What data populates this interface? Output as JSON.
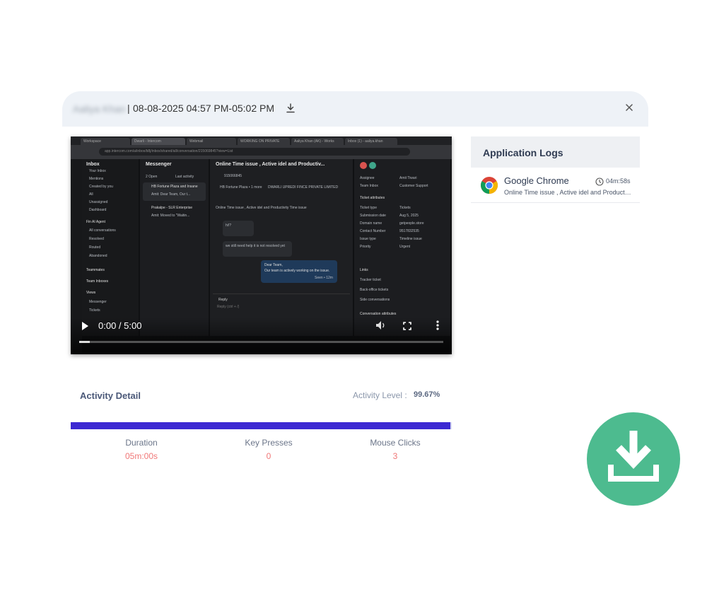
{
  "header": {
    "user_name": "Aaliya Khan",
    "separator": "|",
    "session_time": "08-08-2025 04:57 PM-05:02 PM"
  },
  "video": {
    "current_time": "0:00",
    "duration": "5:00",
    "time_display": "0:00 / 5:00",
    "progress_fraction": 0.03,
    "screen": {
      "inbox_title": "Inbox",
      "inbox_items": [
        "Your Inbox",
        "Mentions",
        "Created by you",
        "All",
        "Unassigned",
        "Dashboard"
      ],
      "section_ai": "Fin AI Agent",
      "ai_items": [
        "All conversations",
        "Resolved",
        "Routed",
        "Abandoned"
      ],
      "section_teammates": "Teammates",
      "section_team_inboxes": "Team Inboxes",
      "section_views": "Views",
      "view_items": [
        "Messenger",
        "Tickets"
      ],
      "messenger_title": "Messenger",
      "messenger_filter": "2 Open",
      "messenger_sort": "Last activity",
      "conversations": [
        {
          "title": "HB Fortune Plaza and Insane",
          "preview": "Amit: Dear Team, Our t..."
        },
        {
          "title": "Prakalpe - SLR Enterprise",
          "preview": "Amit: Moved to \"Waitin..."
        }
      ],
      "chat_title": "Online Time issue , Active idel and Productiv...",
      "chat_id": "915066845",
      "chat_company": "HB Fortune Plaza • 1 more",
      "chat_org": "DWARLI UPREDI FINCE PRIVATE LIMITED",
      "chat_subject": "Online Time issue , Active idel and Productivity Time issue",
      "msg1": "hi!?",
      "msg2": "we still need help it is not resolved yet",
      "msg3_line1": "Dear Team,",
      "msg3_line2": "Our team is actively working on the issue.",
      "msg3_meta": "Seen • 12m",
      "reply_label": "Reply",
      "reply_placeholder": "Reply (ctrl + /)",
      "side_assignee_label": "Assignee",
      "side_assignee": "Amit Tiwari",
      "side_team_label": "Team Inbox",
      "side_team": "Customer Support",
      "side_ticket_section": "Ticket attributes",
      "side_rows": [
        [
          "Ticket type",
          "Tickets"
        ],
        [
          "Submission date",
          "Aug 5, 2025"
        ],
        [
          "Domain name",
          "getpeople.store"
        ],
        [
          "Contact Number",
          "9517832535"
        ],
        [
          "Issue type",
          "Timeline issue"
        ],
        [
          "Priority",
          "Urgent"
        ]
      ],
      "side_links": "Links",
      "side_link_items": [
        "Tracker ticket",
        "Back-office tickets",
        "Side conversations"
      ],
      "side_conv_attrs": "Conversation attributes",
      "tabs": [
        "Workspace",
        "Dwarli - Intercom",
        "Webmail",
        "WORKING ON PRIVATE",
        "Aaliya Khan (AK) - Works",
        "Inbox (1) - aaliya.khan"
      ],
      "url": "app.intercom.com/a/inbox/b8j/inbox/shared/all/conversation/215069845?view=List"
    }
  },
  "app_logs": {
    "title": "Application Logs",
    "items": [
      {
        "name": "Google Chrome",
        "duration": "04m:58s",
        "description": "Online Time issue , Active idel and Productivity Time issue"
      }
    ]
  },
  "activity": {
    "title": "Activity Detail",
    "level_label": "Activity Level :",
    "level_value": "99.67%",
    "level_fraction": 0.9967,
    "metrics": [
      {
        "label": "Duration",
        "value": "05m:00s"
      },
      {
        "label": "Key Presses",
        "value": "0"
      },
      {
        "label": "Mouse Clicks",
        "value": "3"
      }
    ]
  },
  "colors": {
    "accent_bar": "#3c28d2",
    "metric_value": "#f07878",
    "download_circle": "#4dbb8f"
  },
  "icons": {
    "header_download": "download-icon",
    "close": "close-icon",
    "big_download": "download-icon",
    "chrome": "google-chrome-icon",
    "clock": "clock-icon"
  }
}
